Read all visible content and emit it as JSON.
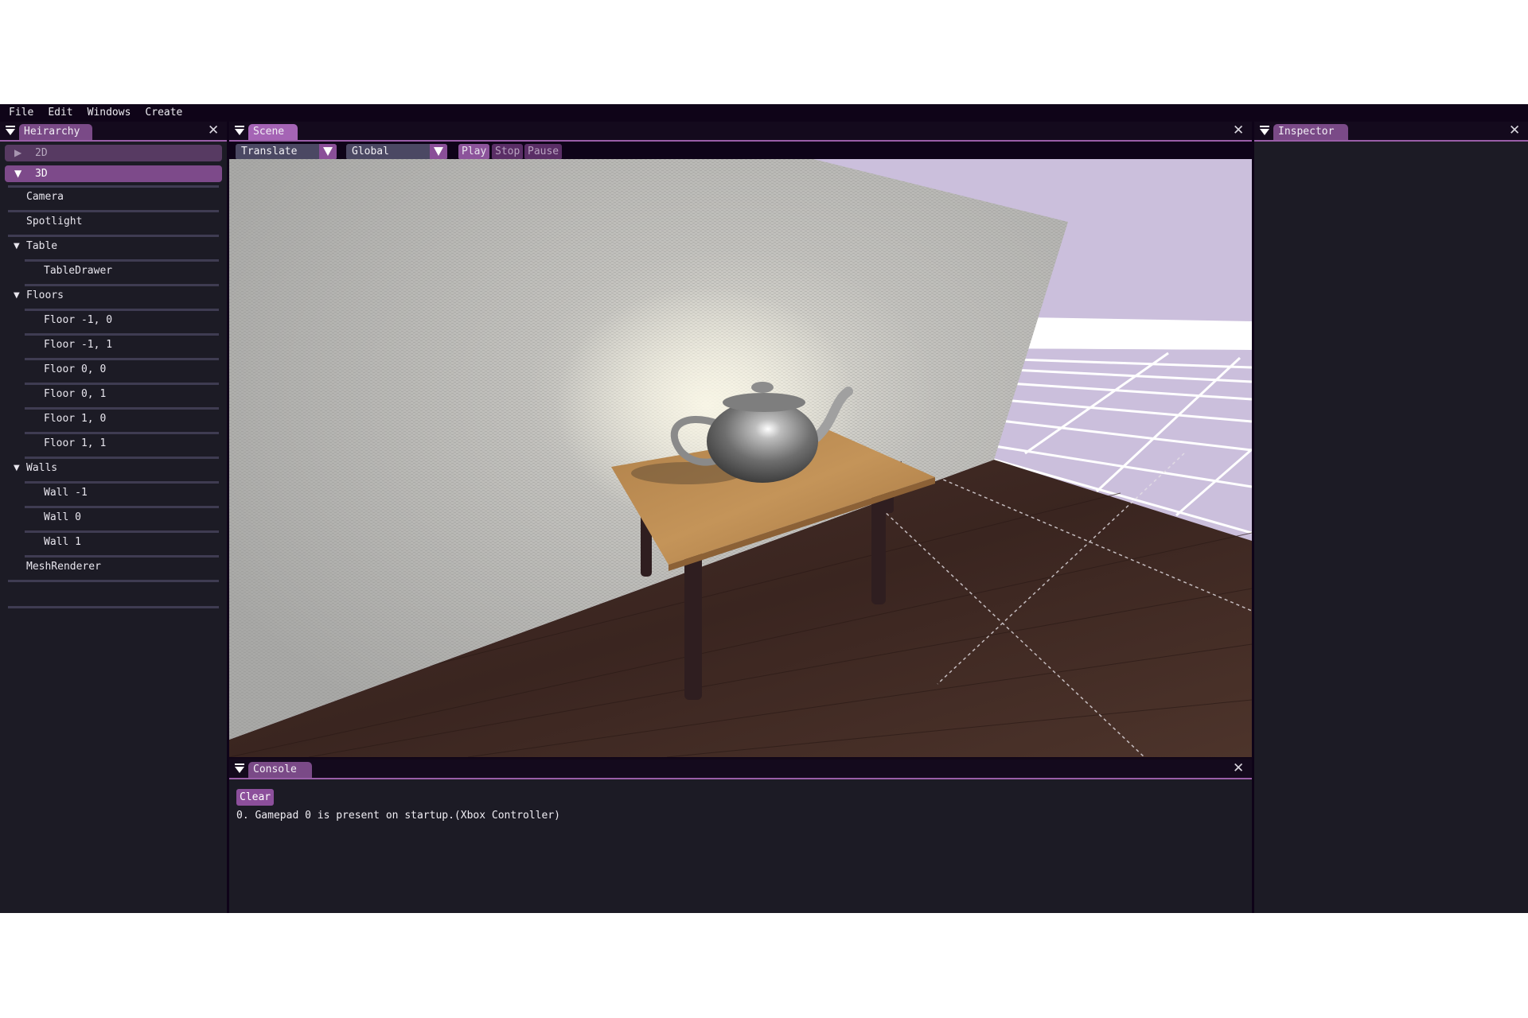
{
  "menubar": {
    "items": [
      "File",
      "Edit",
      "Windows",
      "Create"
    ]
  },
  "hierarchy": {
    "title": "Heirarchy",
    "groups": [
      {
        "label": "2D",
        "expanded": false
      },
      {
        "label": "3D",
        "expanded": true
      }
    ],
    "items": [
      {
        "label": "Camera",
        "depth": 0,
        "expandable": false
      },
      {
        "label": "Spotlight",
        "depth": 0,
        "expandable": false
      },
      {
        "label": "Table",
        "depth": 0,
        "expandable": true
      },
      {
        "label": "TableDrawer",
        "depth": 1,
        "expandable": false
      },
      {
        "label": "Floors",
        "depth": 0,
        "expandable": true
      },
      {
        "label": "Floor -1, 0",
        "depth": 1,
        "expandable": false
      },
      {
        "label": "Floor -1, 1",
        "depth": 1,
        "expandable": false
      },
      {
        "label": "Floor 0, 0",
        "depth": 1,
        "expandable": false
      },
      {
        "label": "Floor 0, 1",
        "depth": 1,
        "expandable": false
      },
      {
        "label": "Floor 1, 0",
        "depth": 1,
        "expandable": false
      },
      {
        "label": "Floor 1, 1",
        "depth": 1,
        "expandable": false
      },
      {
        "label": "Walls",
        "depth": 0,
        "expandable": true
      },
      {
        "label": "Wall -1",
        "depth": 1,
        "expandable": false
      },
      {
        "label": "Wall 0",
        "depth": 1,
        "expandable": false
      },
      {
        "label": "Wall 1",
        "depth": 1,
        "expandable": false
      },
      {
        "label": "MeshRenderer",
        "depth": 0,
        "expandable": false
      }
    ]
  },
  "scene": {
    "title": "Scene",
    "transform_mode": "Translate",
    "space_mode": "Global",
    "buttons": {
      "play": "Play",
      "stop": "Stop",
      "pause": "Pause"
    },
    "objects": [
      "wall",
      "table",
      "teapot",
      "wood-floor",
      "grid-floor",
      "sky"
    ]
  },
  "inspector": {
    "title": "Inspector"
  },
  "console": {
    "title": "Console",
    "clear_label": "Clear",
    "lines": [
      "0. Gamepad 0 is present on startup.(Xbox Controller)"
    ]
  },
  "icons": {
    "collapse": "collapse-triangle-icon",
    "close": "close-icon",
    "expanded": "▼",
    "collapsed": "▶",
    "close_glyph": "✕"
  },
  "colors": {
    "accent": "#a564b5",
    "tab": "#7a4a87",
    "panel_bg": "#1c1b25",
    "menubar_bg": "#0f0418",
    "header_selected": "#7d4a8a",
    "header_unselected": "#573a62"
  }
}
